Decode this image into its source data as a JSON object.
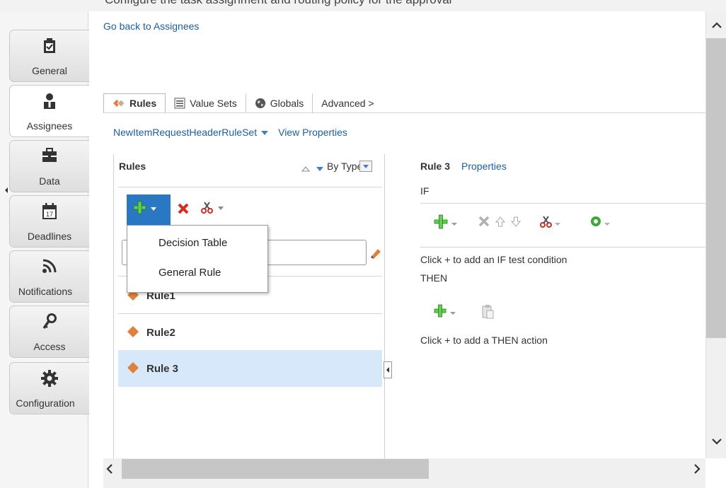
{
  "window": {
    "top_text": "Configure the task assignment and routing policy for the approval"
  },
  "nav": {
    "tabs": [
      {
        "name": "general",
        "label": "General"
      },
      {
        "name": "assignees",
        "label": "Assignees"
      },
      {
        "name": "data",
        "label": "Data"
      },
      {
        "name": "deadlines",
        "label": "Deadlines"
      },
      {
        "name": "notifications",
        "label": "Notifications"
      },
      {
        "name": "access",
        "label": "Access"
      },
      {
        "name": "configuration",
        "label": "Configuration"
      }
    ],
    "active": "Assignees",
    "deadlines_icon_number": "17"
  },
  "header": {
    "back_link": "Go back to Assignees"
  },
  "tabs": {
    "rules": "Rules",
    "value_sets": "Value Sets",
    "globals": "Globals",
    "advanced": "Advanced >"
  },
  "ruleset": {
    "name": "NewItemRequestHeaderRuleSet",
    "view_properties": "View Properties"
  },
  "rules_panel": {
    "title": "Rules",
    "sort_label": "By Type",
    "add_menu": [
      "Decision Table",
      "General Rule"
    ],
    "rules": [
      {
        "label": "Rule1",
        "selected": false
      },
      {
        "label": "Rule2",
        "selected": false
      },
      {
        "label": "Rule 3",
        "selected": true
      }
    ]
  },
  "detail": {
    "rule_title": "Rule 3",
    "properties_link": "Properties",
    "if_label": "IF",
    "if_hint": "Click + to add an IF test condition",
    "then_label": "THEN",
    "then_hint": "Click + to add a THEN action"
  },
  "colors": {
    "link": "#1b5e9b",
    "selected_row": "#d6e8fa",
    "add_green": "#3aaa35",
    "delete_red": "#d62b1f",
    "rule_icon": "#e0803a"
  }
}
